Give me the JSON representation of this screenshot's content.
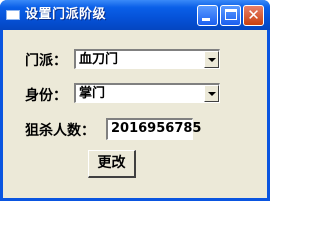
{
  "window": {
    "title": "设置门派阶级",
    "minimize_icon": "minimize-icon",
    "maximize_icon": "maximize-icon",
    "close_icon": "close-icon"
  },
  "form": {
    "sect_label": "门派：",
    "sect_value": "血刀门",
    "rank_label": "身份：",
    "rank_value": "掌门",
    "kills_label": "狙杀人数：",
    "kills_value": "2016956785",
    "submit_label": "更改"
  }
}
